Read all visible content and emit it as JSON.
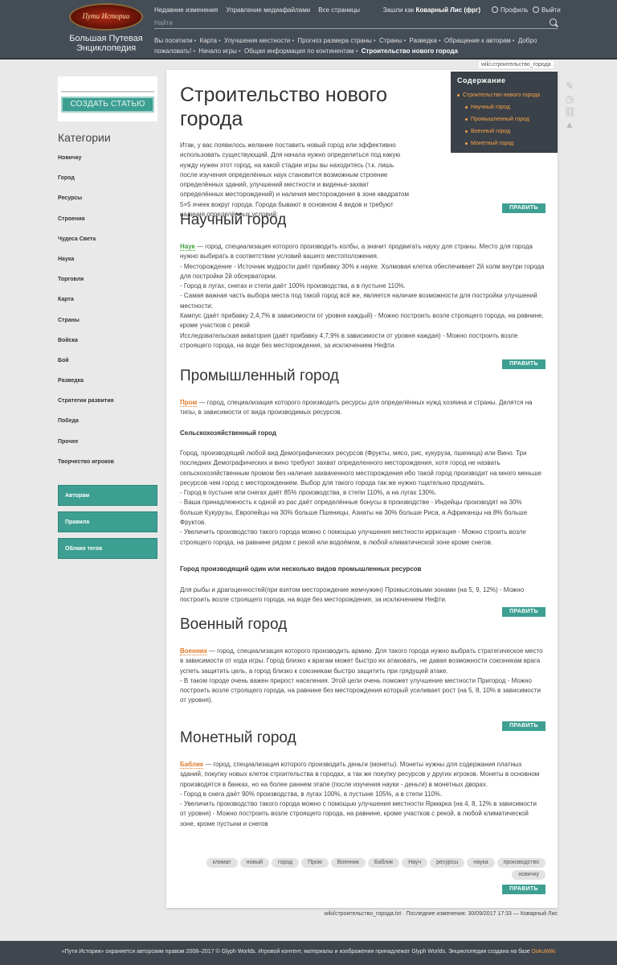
{
  "header": {
    "logo_text": "Пути Истории",
    "site_title": "Большая Путевая Энциклопедия",
    "nav_left": [
      "Недавние изменения",
      "Управление медиафайлами",
      "Все страницы"
    ],
    "logged_in_prefix": "Зашли как",
    "logged_in_user": "Коварный Лис (фрг)",
    "profile": "Профиль",
    "logout": "Выйти",
    "search_placeholder": "Найти",
    "breadcrumb_items": [
      "Вы посетили",
      "Карта",
      "Улучшения местности",
      "Прогноз размера страны",
      "Страны",
      "Разведка",
      "Обращение к авторам",
      "Добро пожаловать!",
      "Начало игры",
      "Общая информация по континентам"
    ],
    "breadcrumb_current": "Строительство нового города"
  },
  "sidebar": {
    "create_article": "СОЗДАТЬ СТАТЬЮ",
    "categories_heading": "Категории",
    "categories": [
      "Новичку",
      "Город",
      "Ресурсы",
      "Строения",
      "Чудеса Света",
      "Наука",
      "Торговля",
      "Карта",
      "Страны",
      "Войска",
      "Бой",
      "Разведка",
      "Стратегии развития",
      "Победа",
      "Прочее",
      "Творчество игроков"
    ],
    "buttons": [
      "Авторам",
      "Правила",
      "Облако тегов"
    ]
  },
  "page": {
    "page_id": "wiki:строительство_города",
    "title": "Строительство нового города",
    "intro": "Итак, у вас появилось желание поставить новый город или эффективно использовать существующий. Для начала нужно определиться под какую нужду нужен этот город, на какой стадии игры вы находитесь (т.к. лишь после изучения определённых наук становится возможным строение определённых зданий, улучшений местности и виденье-захват определённых месторождений) и наличия месторождения в зоне квадратом 5×5 ячеек вокруг города. Города бывают в основном 4 видов и требуют наличия определённых условий:",
    "edit_label": "ПРАВИТЬ",
    "sections": {
      "science": {
        "heading": "Научный город",
        "keyword": "Наук",
        "lines": [
          " — город, специализация которого производить колбы, а значит продвигать науку для страны. Место для города нужно выбирать в соответствии условий вашего местоположения.",
          "- Месторождение - Источник мудрости даёт прибавку 30% к науке. Холмовая клетка обеспечивает 2й холм внутри города для постройки 2й обсерватории.",
          "- Город в лугах, снегах и степи даёт 100% производства, а в пустыне 110%.",
          "- Самая важная часть выбора места под такой город всё же, является наличие возможности для постройки улучшений местности:",
          "Кампус (даёт прибавку 2,4,7% в зависимости от уровня каждый) - Можно построить возле строящего города, на равнине, кроме участков с рекой",
          "Исследовательская акватория (даёт прибавку 4,7,9% в зависимости от уровня каждая) - Можно построить возле строящего города, на воде без месторождения, за исключением Нефти."
        ]
      },
      "industry": {
        "heading": "Промышленный город",
        "keyword": "Пром",
        "intro": " — город, специализация которого производить ресурсы для определённых нужд хозяина и страны. Делятся на типы, в зависимости от вида производимых ресурсов.",
        "sub1_title": "Сельскохозяйственный город",
        "sub1_lines": [
          "Город, производящий любой вид Демографических ресурсов (Фрукты, мясо, рис, кукуруза, пшеница) или Вино. Три последних Демографических и вино требуют захват определенного месторождения, хотя город не назвать сельскохозяйственным промом без наличия захваченного месторождения ибо такой город производит на много меньше ресурсов чем город с месторождением. Выбор для такого города так же нужно тщательно продумать.",
          "- Город в пустыне или снегах даёт 85% производства, в степи 110%, а на лугах 130%.",
          "- Ваша принадлежность к одной из рас даёт определённые бонусы в производстве - Индейцы производят на 30% больше Кукурузы, Европейцы на 30% больше Пшеницы, Азиаты на 30% больше Риса, а Африканцы на 8% больше Фруктов.",
          "- Увеличить производство такого города можно с помощью улучшения местности ирригация - Можно строить возле строящего города, на равнине рядом с рекой или водоёмом, в любой климатической зоне кроме снегов."
        ],
        "sub2_title": "Город производящий один или несколько видов промышленных ресурсов",
        "sub2_lines": [
          "Для рыбы и драгоценностей(при взятом месторождение жемчужин) Промысловыми зонами (на 5, 9, 12%) - Можно построить возле строящего города, на воде без месторождения, за исключением Нефти."
        ]
      },
      "military": {
        "heading": "Военный город",
        "keyword": "Военник",
        "lines": [
          " — город, специализация которого производить армию. Для такого города нужно выбрать стратегическое место в зависимости от хода игры. Город близко к врагам может быстро их атаковать, не давая возможности союзникам врага успеть защитить цель, а город близко к союзникам быстро защитить при грядущей атаке.",
          "- В таком городе очень важен прирост населения. Этой цели очень поможет улучшение местности Пригород - Можно построить возле строящего города, на равнине без месторождения который усиливает рост (на 5, 8, 10% в зависимости от уровня)."
        ]
      },
      "money": {
        "heading": "Монетный город",
        "keyword": "Баблик",
        "lines": [
          " — город, специализация которого производить деньги (монеты). Монеты нужны для содержания платных зданий, покупку новых клеток строительства в городах, а так же покупку ресурсов у других игроков. Монеты в основном производятся в банках, но на более раннем этапе (после изучения науки - деньги) в монетных дворах.",
          "- Город в снега даёт 90% производства, в лугах 100%, в пустыне 105%, а в степи 110%.",
          "- Увеличить производство такого города можно с помощью улучшения местности Ярмарка (на 4, 8, 12% в зависимости от уровня) - Можно построить возле строящего города, на равнине, кроме участков с рекой, в любой климатической зоне, кроме пустыни и снегов"
        ]
      }
    },
    "toc": {
      "title": "Содержание",
      "items": [
        "Строительство нового города",
        "Научный город",
        "Промышленный город",
        "Военный город",
        "Монетный город"
      ]
    },
    "tags": [
      "климат",
      "новый",
      "город",
      "Пром",
      "Военник",
      "Баблик",
      "Науч",
      "ресурсы",
      "наука",
      "производство",
      "новичку"
    ],
    "footer_info": "wiki/строительство_города.txt · Последние изменения: 30/09/2017 17:33 — Коварный Лис"
  },
  "footer": {
    "text": "«Пути Истории» охраняется авторским правом 2008–2017 © Glyph Worlds. Игровой контент, материалы и изображения принадлежат Glyph Worlds. Энциклопедия создана на базе ",
    "link": "DokuWiki"
  },
  "colors": {
    "header_bg": "#444c55",
    "accent_teal": "#3d9f92",
    "toc_link": "#f7a34a",
    "keyword_green": "#3d9f3d",
    "keyword_orange": "#e07a2a"
  }
}
